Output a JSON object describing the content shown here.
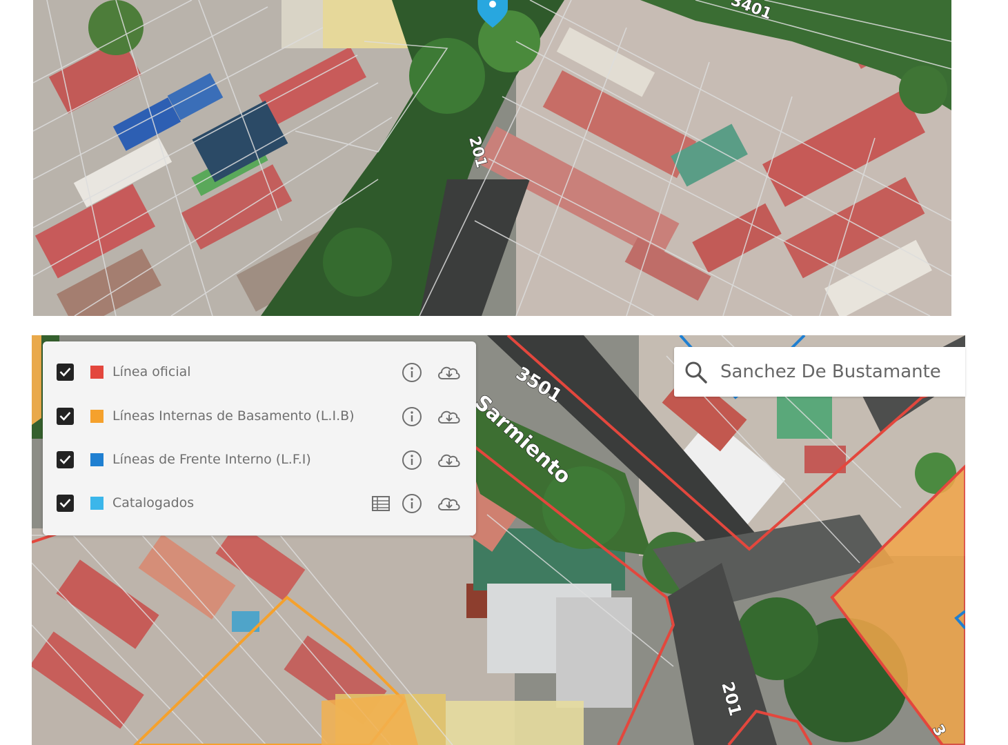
{
  "map": {
    "top_panel": {
      "basemap": "satellite",
      "street_labels": [
        "3401",
        "201"
      ]
    },
    "bottom_panel": {
      "basemap": "satellite",
      "street_labels": [
        "3501",
        "Sarmiento",
        "201",
        "3"
      ]
    }
  },
  "legend": {
    "layers": [
      {
        "label": "Línea oficial",
        "checked": true,
        "color": "#e3473d",
        "icons": [
          "info-icon",
          "cloud-download-icon"
        ]
      },
      {
        "label": "Líneas Internas de Basamento (L.I.B)",
        "checked": true,
        "color": "#f5a12c",
        "icons": [
          "info-icon",
          "cloud-download-icon"
        ]
      },
      {
        "label": "Líneas de Frente Interno (L.F.I)",
        "checked": true,
        "color": "#1f7fd1",
        "icons": [
          "info-icon",
          "cloud-download-icon"
        ]
      },
      {
        "label": "Catalogados",
        "checked": true,
        "color": "#3bb6ea",
        "icons": [
          "table-icon",
          "info-icon",
          "cloud-download-icon"
        ]
      }
    ]
  },
  "search": {
    "value": "Sanchez De Bustamante"
  },
  "colors": {
    "linea_oficial": "#e3473d",
    "lib": "#f5a12c",
    "lfi": "#1f7fd1",
    "catalogados": "#3bb6ea",
    "pin": "#28a7df"
  }
}
